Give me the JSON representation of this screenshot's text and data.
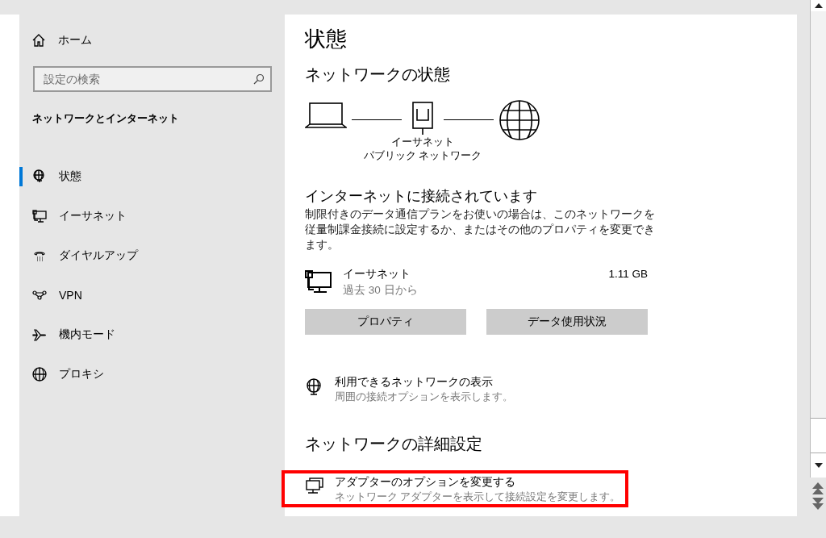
{
  "sidebar": {
    "home": "ホーム",
    "search": {
      "placeholder": "設定の検索"
    },
    "section_title": "ネットワークとインターネット",
    "items": [
      {
        "label": "状態",
        "selected": true
      },
      {
        "label": "イーサネット",
        "selected": false
      },
      {
        "label": "ダイヤルアップ",
        "selected": false
      },
      {
        "label": "VPN",
        "selected": false
      },
      {
        "label": "機内モード",
        "selected": false
      },
      {
        "label": "プロキシ",
        "selected": false
      }
    ]
  },
  "content": {
    "title": "状態",
    "section_title": "ネットワークの状態",
    "diagram": {
      "adapter_name": "イーサネット",
      "network_type": "パブリック ネットワーク"
    },
    "connection_status": "インターネットに接続されています",
    "description": "制限付きのデータ通信プランをお使いの場合は、このネットワークを従量制課金接続に設定するか、またはその他のプロパティを変更できます。",
    "adapter": {
      "name": "イーサネット",
      "period": "過去 30 日から",
      "usage": "1.11 GB"
    },
    "buttons": [
      "プロパティ",
      "データ使用状況"
    ],
    "links": [
      {
        "title": "利用できるネットワークの表示",
        "subtitle": "周囲の接続オプションを表示します。",
        "highlighted": false
      }
    ],
    "advanced_title": "ネットワークの詳細設定",
    "advanced_links": [
      {
        "title": "アダプターのオプションを変更する",
        "subtitle": "ネットワーク アダプターを表示して接続設定を変更します。",
        "highlighted": true
      }
    ]
  }
}
